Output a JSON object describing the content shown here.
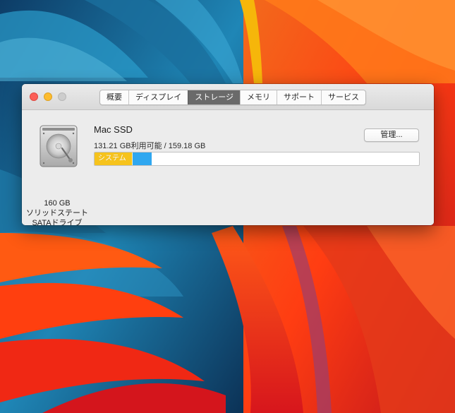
{
  "window": {
    "tabs": [
      {
        "label": "概要",
        "active": false
      },
      {
        "label": "ディスプレイ",
        "active": false
      },
      {
        "label": "ストレージ",
        "active": true
      },
      {
        "label": "メモリ",
        "active": false
      },
      {
        "label": "サポート",
        "active": false
      },
      {
        "label": "サービス",
        "active": false
      }
    ]
  },
  "drive": {
    "icon": "hard-drive-icon",
    "capacity": "160 GB",
    "type_line1": "ソリッドステート",
    "type_line2": "SATAドライブ"
  },
  "disk": {
    "name": "Mac SSD",
    "usage": "131.21 GB利用可能 / 159.18 GB",
    "manage_label": "管理..."
  },
  "storage_bar": {
    "segments": [
      {
        "label": "システム",
        "fraction": 0.117,
        "color": "#f6c31c"
      },
      {
        "label": "",
        "fraction": 0.058,
        "color": "#2fa7f0"
      }
    ],
    "free_color": "#ffffff"
  },
  "colors": {
    "close": "#fc5f57",
    "minimize": "#fdbc2e",
    "zoom_disabled": "#cdcdcd",
    "active_tab": "#6a6a6a"
  }
}
